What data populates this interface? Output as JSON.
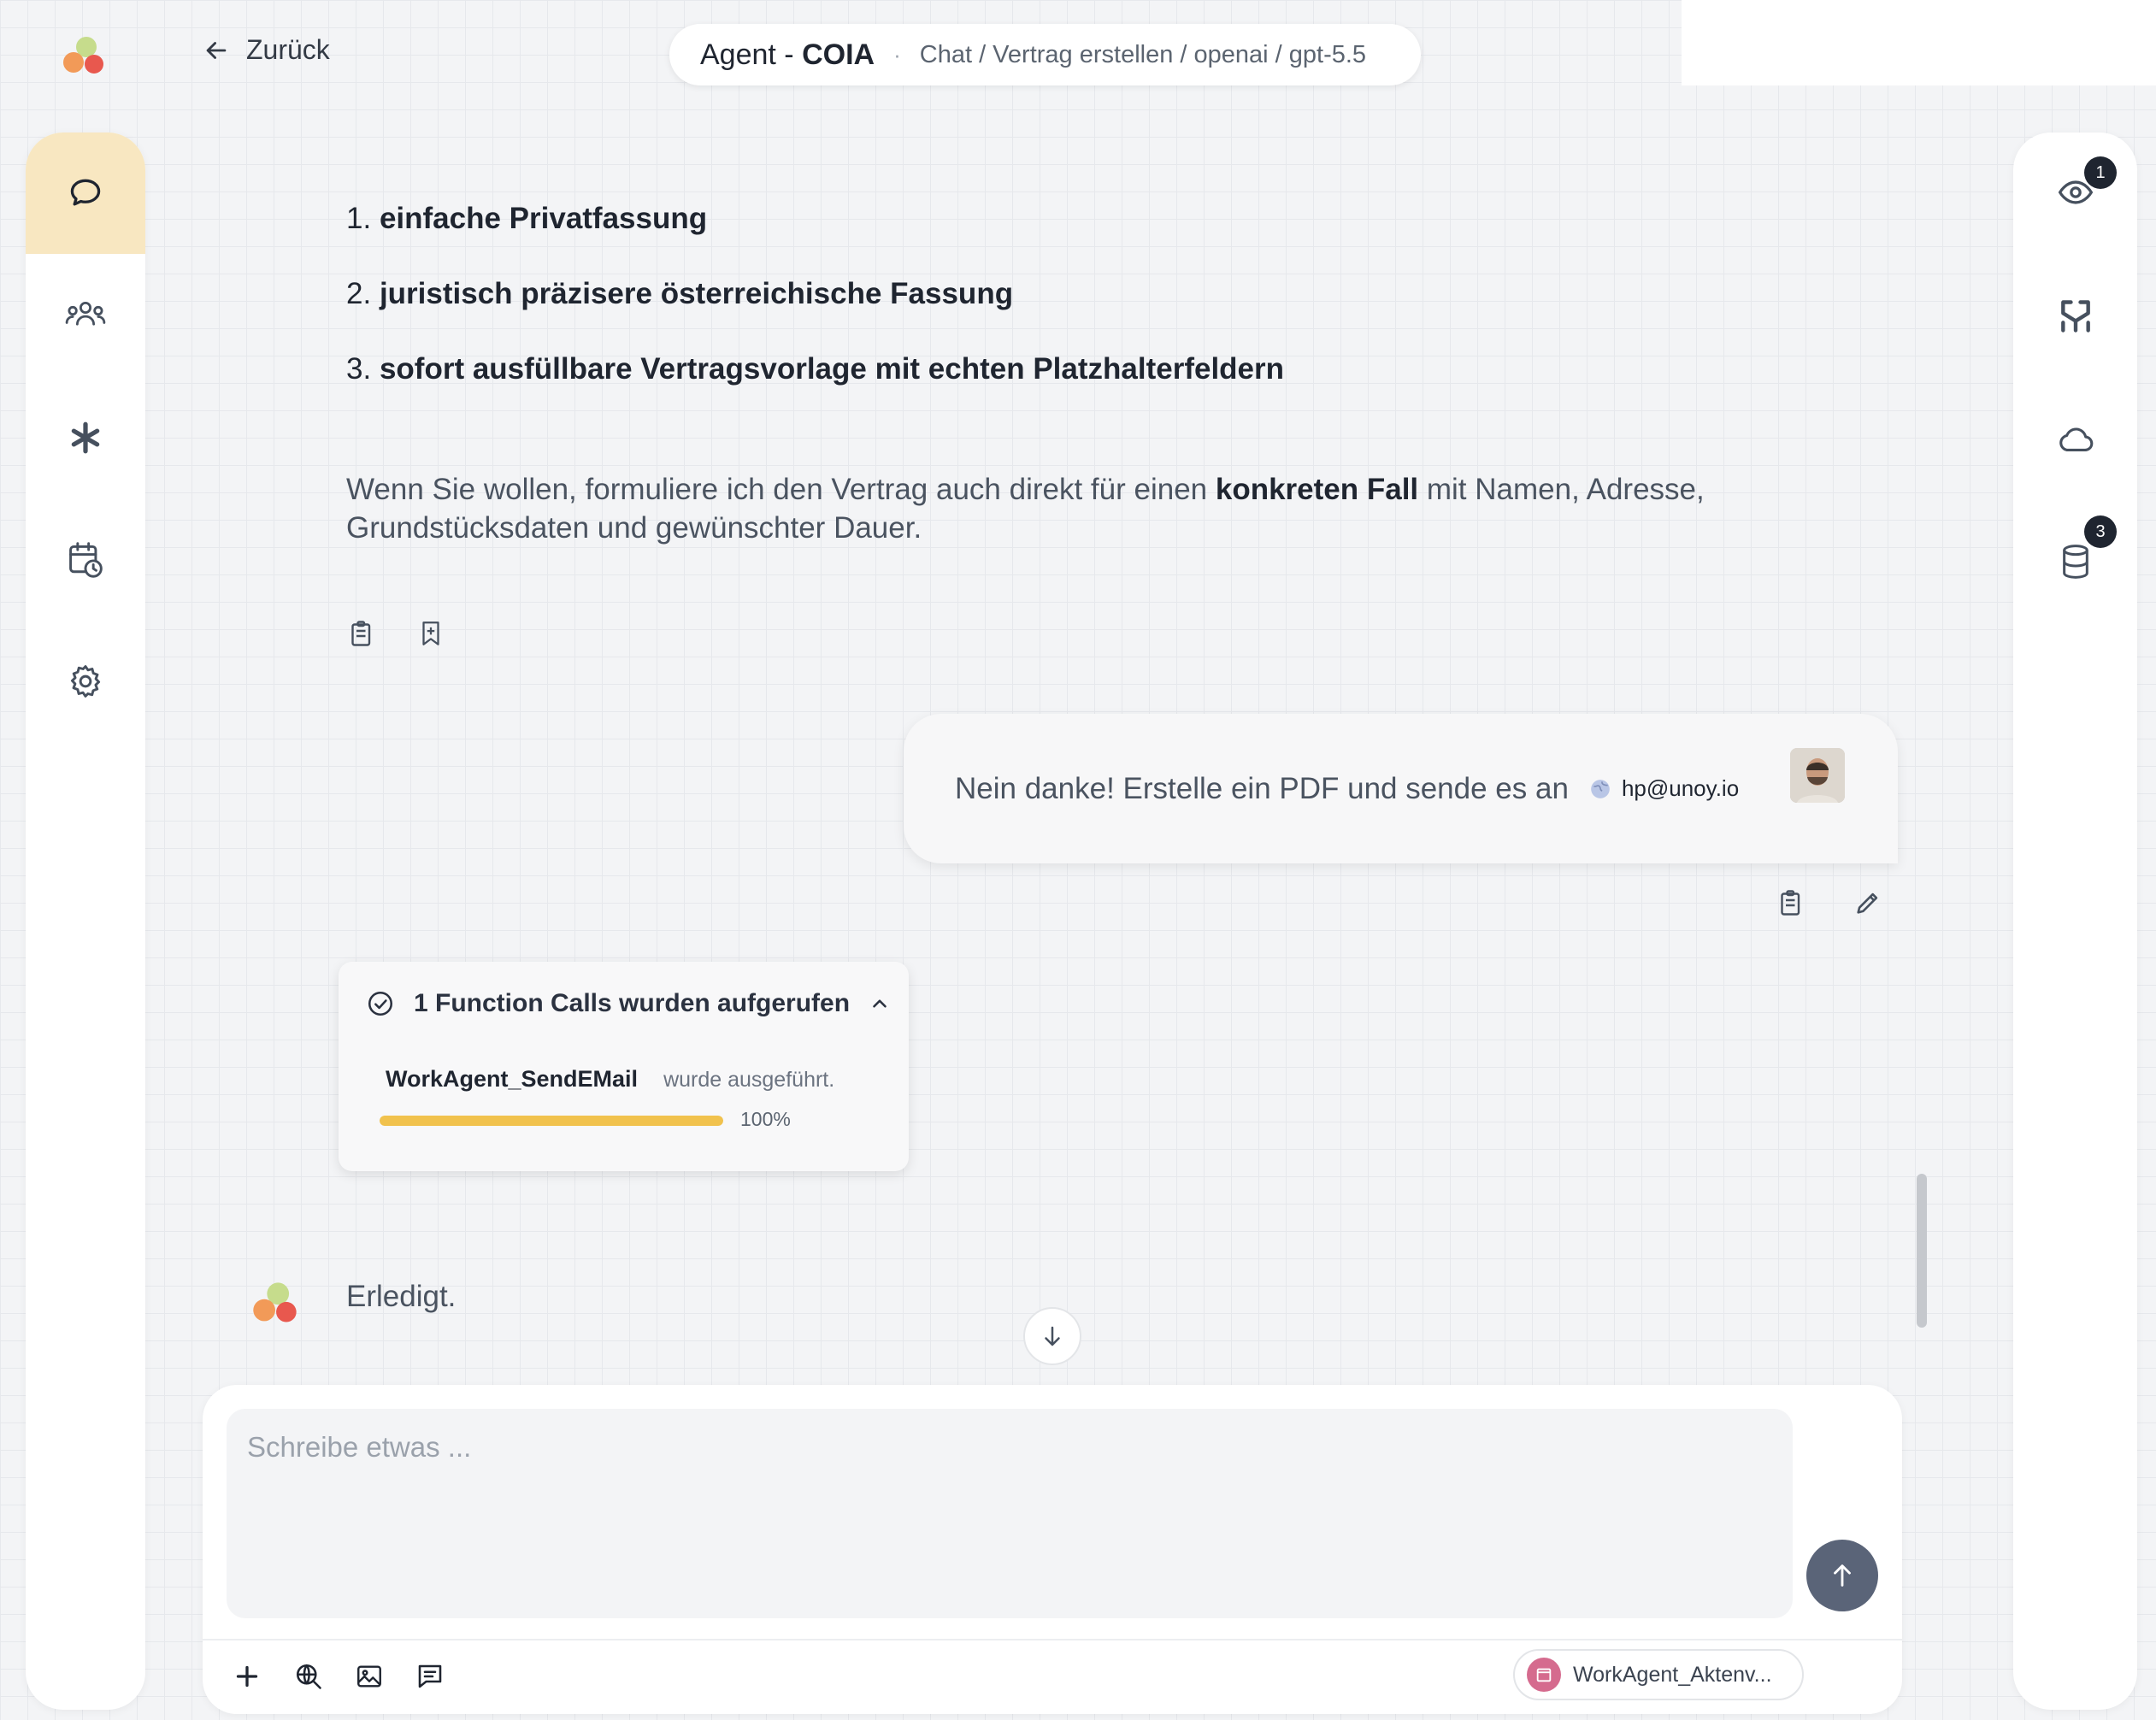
{
  "header": {
    "back_label": "Zurück",
    "agent_prefix": "Agent - ",
    "agent_name": "COIA",
    "separator": "·",
    "breadcrumb": "Chat / Vertrag erstellen / openai / gpt-5.5"
  },
  "left_sidebar": {
    "items": [
      {
        "icon": "chat-icon",
        "active": true
      },
      {
        "icon": "users-icon",
        "active": false
      },
      {
        "icon": "asterisk-icon",
        "active": false
      },
      {
        "icon": "calendar-clock-icon",
        "active": false
      },
      {
        "icon": "gear-icon",
        "active": false
      }
    ]
  },
  "right_sidebar": {
    "items": [
      {
        "icon": "eye-icon",
        "badge": "1"
      },
      {
        "icon": "merge-icon",
        "badge": null
      },
      {
        "icon": "cloud-icon",
        "badge": null
      },
      {
        "icon": "database-icon",
        "badge": "3"
      }
    ]
  },
  "assistant_message": {
    "list": [
      {
        "num": "1.",
        "text": "einfache Privatfassung"
      },
      {
        "num": "2.",
        "text": "juristisch präzisere österreichische Fassung"
      },
      {
        "num": "3.",
        "text": "sofort ausfüllbare Vertragsvorlage mit echten Platzhalterfeldern"
      }
    ],
    "para_before": "Wenn Sie wollen, formuliere ich den Vertrag auch direkt für einen ",
    "para_bold": "konkreten Fall",
    "para_after": " mit Namen, Adresse, Grundstücksdaten und gewünschter Dauer."
  },
  "user_message": {
    "text": "Nein danke! Erstelle ein PDF und sende es an",
    "mention": "hp@unoy.io"
  },
  "function_calls": {
    "title": "1 Function Calls wurden aufgerufen",
    "calls": [
      {
        "name": "WorkAgent_SendEMail",
        "status": "wurde ausgeführt.",
        "progress_label": "100%",
        "progress": 1.0
      }
    ]
  },
  "final_message": "Erledigt.",
  "composer": {
    "placeholder": "Schreibe etwas ...",
    "agent_chip": "WorkAgent_Aktenv..."
  },
  "colors": {
    "accent_active": "#f8e7c1",
    "progress": "#f1c24d",
    "send_button": "#5a6478",
    "text_dark": "#1f2530"
  }
}
